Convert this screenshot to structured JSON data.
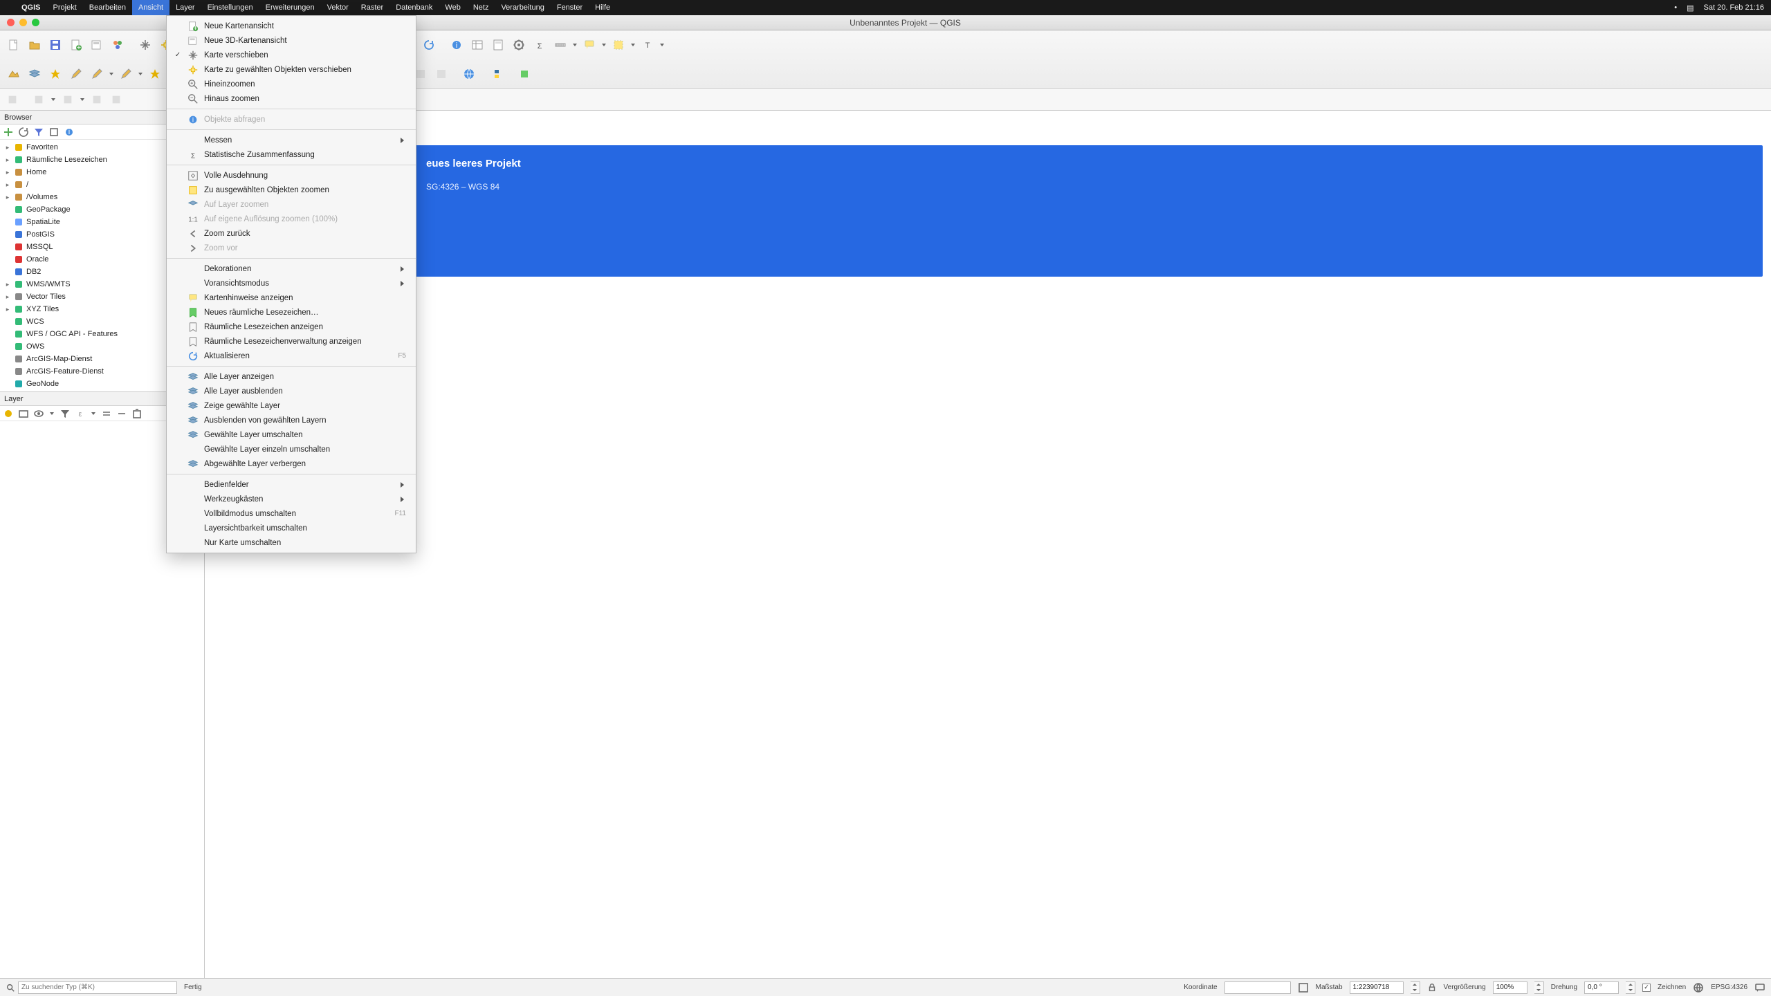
{
  "menubar": {
    "app": "QGIS",
    "items": [
      "Projekt",
      "Bearbeiten",
      "Ansicht",
      "Layer",
      "Einstellungen",
      "Erweiterungen",
      "Vektor",
      "Raster",
      "Datenbank",
      "Web",
      "Netz",
      "Verarbeitung",
      "Fenster",
      "Hilfe"
    ],
    "active_index": 2,
    "clock": "Sat 20. Feb  21:16"
  },
  "window": {
    "title": "Unbenanntes Projekt — QGIS"
  },
  "dropdown": {
    "groups": [
      [
        {
          "icon": "map",
          "label": "Neue Kartenansicht"
        },
        {
          "icon": "map3d",
          "label": "Neue 3D-Kartenansicht"
        },
        {
          "icon": "pan",
          "label": "Karte verschieben",
          "checked": true
        },
        {
          "icon": "pan-sel",
          "label": "Karte zu gewählten Objekten verschieben"
        },
        {
          "icon": "zoom-in",
          "label": "Hineinzoomen"
        },
        {
          "icon": "zoom-out",
          "label": "Hinaus zoomen"
        }
      ],
      [
        {
          "icon": "identify",
          "label": "Objekte abfragen",
          "disabled": true
        }
      ],
      [
        {
          "label": "Messen",
          "submenu": true
        },
        {
          "icon": "sigma",
          "label": "Statistische Zusammenfassung"
        }
      ],
      [
        {
          "icon": "zoom-full",
          "label": "Volle Ausdehnung"
        },
        {
          "icon": "zoom-sel",
          "label": "Zu ausgewählten Objekten zoomen"
        },
        {
          "icon": "zoom-layer",
          "label": "Auf Layer zoomen",
          "disabled": true
        },
        {
          "icon": "zoom-native",
          "label": "Auf eigene Auflösung zoomen (100%)",
          "disabled": true
        },
        {
          "icon": "zoom-last",
          "label": "Zoom zurück"
        },
        {
          "icon": "zoom-next",
          "label": "Zoom vor",
          "disabled": true
        }
      ],
      [
        {
          "label": "Dekorationen",
          "submenu": true
        },
        {
          "label": "Voransichtsmodus",
          "submenu": true
        },
        {
          "icon": "tip",
          "label": "Kartenhinweise anzeigen"
        },
        {
          "icon": "bookmark-new",
          "label": "Neues räumliche Lesezeichen…"
        },
        {
          "icon": "bookmark-show",
          "label": "Räumliche Lesezeichen anzeigen"
        },
        {
          "icon": "bookmark-mgr",
          "label": "Räumliche Lesezeichenverwaltung anzeigen"
        },
        {
          "icon": "refresh",
          "label": "Aktualisieren",
          "shortcut": "F5"
        }
      ],
      [
        {
          "icon": "layer-show",
          "label": "Alle Layer anzeigen"
        },
        {
          "icon": "layer-hide",
          "label": "Alle Layer ausblenden"
        },
        {
          "icon": "layer-show-sel",
          "label": "Zeige gewählte Layer"
        },
        {
          "icon": "layer-hide-sel",
          "label": "Ausblenden von gewählten Layern"
        },
        {
          "icon": "layer-toggle",
          "label": "Gewählte Layer umschalten"
        },
        {
          "label": "Gewählte Layer einzeln umschalten"
        },
        {
          "icon": "layer-hide-unsel",
          "label": "Abgewählte Layer verbergen"
        }
      ],
      [
        {
          "label": "Bedienfelder",
          "submenu": true
        },
        {
          "label": "Werkzeugkästen",
          "submenu": true
        },
        {
          "label": "Vollbildmodus umschalten",
          "shortcut": "F11"
        },
        {
          "label": "Layersichtbarkeit umschalten"
        },
        {
          "label": "Nur Karte umschalten"
        }
      ]
    ]
  },
  "browser": {
    "title": "Browser",
    "items": [
      {
        "icon": "star",
        "label": "Favoriten",
        "exp": "▸",
        "color": "#e8b500"
      },
      {
        "icon": "bookmark",
        "label": "Räumliche Lesezeichen",
        "exp": "▸",
        "color": "#3b7"
      },
      {
        "icon": "home",
        "label": "Home",
        "exp": "▸",
        "color": "#c89040"
      },
      {
        "icon": "folder",
        "label": "/",
        "exp": "▸",
        "color": "#c89040"
      },
      {
        "icon": "folder",
        "label": "/Volumes",
        "exp": "▸",
        "color": "#c89040"
      },
      {
        "icon": "gpkg",
        "label": "GeoPackage",
        "color": "#3b7"
      },
      {
        "icon": "spatialite",
        "label": "SpatiaLite",
        "color": "#6aa0ff"
      },
      {
        "icon": "postgis",
        "label": "PostGIS",
        "color": "#3a74d8"
      },
      {
        "icon": "mssql",
        "label": "MSSQL",
        "color": "#d33"
      },
      {
        "icon": "oracle",
        "label": "Oracle",
        "color": "#d33"
      },
      {
        "icon": "db2",
        "label": "DB2",
        "color": "#3a74d8"
      },
      {
        "icon": "wms",
        "label": "WMS/WMTS",
        "exp": "▸",
        "color": "#3b7"
      },
      {
        "icon": "vtiles",
        "label": "Vector Tiles",
        "exp": "▸",
        "color": "#888"
      },
      {
        "icon": "xyz",
        "label": "XYZ Tiles",
        "exp": "▸",
        "color": "#3b7"
      },
      {
        "icon": "wcs",
        "label": "WCS",
        "color": "#3b7"
      },
      {
        "icon": "wfs",
        "label": "WFS / OGC API - Features",
        "color": "#3b7"
      },
      {
        "icon": "ows",
        "label": "OWS",
        "color": "#3b7"
      },
      {
        "icon": "arcgis",
        "label": "ArcGIS-Map-Dienst",
        "color": "#888"
      },
      {
        "icon": "arcgis",
        "label": "ArcGIS-Feature-Dienst",
        "color": "#888"
      },
      {
        "icon": "geonode",
        "label": "GeoNode",
        "color": "#2aa"
      }
    ]
  },
  "layer_panel": {
    "title": "Layer"
  },
  "welcome": {
    "title_suffix": "eues leeres Projekt",
    "crs_suffix": "SG:4326 – WGS 84"
  },
  "statusbar": {
    "locate_placeholder": "Zu suchender Typ (⌘K)",
    "ready": "Fertig",
    "coord_label": "Koordinate",
    "coord_value": "",
    "scale_label": "Maßstab",
    "scale_value": "1:22390718",
    "mag_label": "Vergrößerung",
    "mag_value": "100%",
    "rot_label": "Drehung",
    "rot_value": "0,0 °",
    "render_label": "Zeichnen",
    "crs": "EPSG:4326"
  }
}
